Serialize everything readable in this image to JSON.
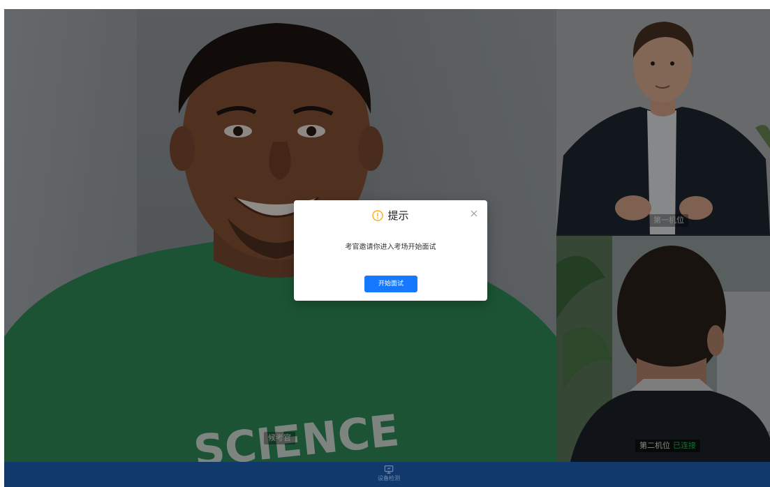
{
  "main_video": {
    "label": "候考官",
    "shirt_text": "SCIENCE"
  },
  "cameras": [
    {
      "label": "第一机位"
    },
    {
      "label": "第二机位",
      "status": "已连接",
      "status_color": "#2bbf52"
    }
  ],
  "modal": {
    "title": "提示",
    "message": "考官邀请你进入考场开始面试",
    "primary_button": "开始面试",
    "icon": "warning-circle-icon",
    "icon_color": "#faad14",
    "button_color": "#1677ff"
  },
  "toolbar": {
    "device_check_label": "设备检测",
    "device_check_icon": "monitor-icon",
    "background_color": "#12396b"
  }
}
